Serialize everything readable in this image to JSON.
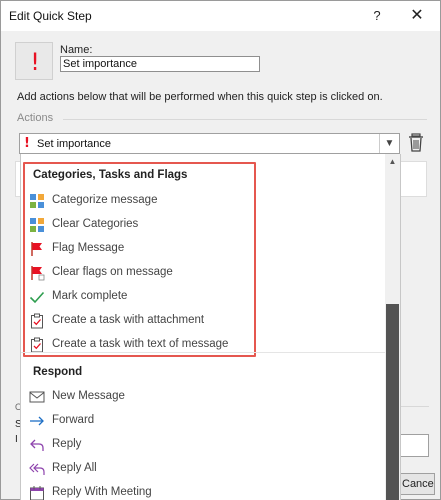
{
  "window": {
    "title": "Edit Quick Step",
    "help_glyph": "?",
    "close_glyph": "✕"
  },
  "quick_step": {
    "icon_glyph": "!",
    "name_label": "Name:",
    "name_value": "Set importance",
    "instructions": "Add actions below that will be performed when this quick step is clicked on.",
    "actions_label": "Actions"
  },
  "action_select": {
    "glyph": "!",
    "selected": "Set importance"
  },
  "background": {
    "o": "O",
    "s": "S",
    "i": "I",
    "cancel": "Cancel"
  },
  "dropdown": {
    "groups": [
      {
        "title": "Categories, Tasks and Flags",
        "items": [
          {
            "label": "Categorize message",
            "icon": "categorize-icon"
          },
          {
            "label": "Clear Categories",
            "icon": "clear-categories-icon"
          },
          {
            "label": "Flag Message",
            "icon": "flag-icon"
          },
          {
            "label": "Clear flags on message",
            "icon": "clear-flag-icon"
          },
          {
            "label": "Mark complete",
            "icon": "checkmark-icon"
          },
          {
            "label": "Create a task with attachment",
            "icon": "task-clipboard-icon"
          },
          {
            "label": "Create a task with text of message",
            "icon": "task-clipboard-icon"
          }
        ]
      },
      {
        "title": "Respond",
        "items": [
          {
            "label": "New Message",
            "icon": "envelope-icon"
          },
          {
            "label": "Forward",
            "icon": "forward-arrow-icon"
          },
          {
            "label": "Reply",
            "icon": "reply-icon"
          },
          {
            "label": "Reply All",
            "icon": "reply-all-icon"
          },
          {
            "label": "Reply With Meeting",
            "icon": "calendar-icon"
          }
        ]
      }
    ]
  },
  "colors": {
    "highlight_border": "#e5574f",
    "importance_red": "#e81123",
    "accent_blue": "#1e6fc5"
  }
}
